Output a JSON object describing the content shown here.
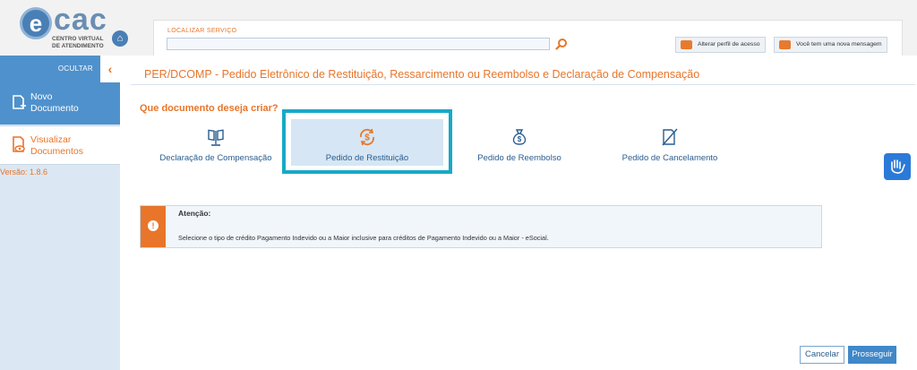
{
  "header": {
    "logo_text": "ecac",
    "logo_subtitle_1": "CENTRO VIRTUAL",
    "logo_subtitle_2": "DE ATENDIMENTO",
    "search_label": "LOCALIZAR SERVIÇO",
    "search_value": "",
    "profile_button": "Alterar perfil de acesso",
    "message_button": "Você tem uma nova mensagem"
  },
  "sidebar": {
    "hide_label": "OCULTAR",
    "new_document_line1": "Novo",
    "new_document_line2": "Documento",
    "view_documents_line1": "Visualizar",
    "view_documents_line2": "Documentos",
    "version": "Versão: 1.8.6"
  },
  "main": {
    "page_title": "PER/DCOMP - Pedido Eletrônico de Restituição, Ressarcimento ou Reembolso e Declaração de Compensação",
    "question": "Que documento deseja criar?",
    "options": [
      {
        "label": "Declaração de Compensação",
        "icon": "scale-icon",
        "selected": false
      },
      {
        "label": "Pedido de Restituição",
        "icon": "refund-cycle-icon",
        "selected": true
      },
      {
        "label": "Pedido de Reembolso",
        "icon": "money-bag-icon",
        "selected": false
      },
      {
        "label": "Pedido de Cancelamento",
        "icon": "cancel-document-icon",
        "selected": false
      }
    ]
  },
  "alert": {
    "title": "Atenção:",
    "text": "Selecione o tipo de crédito Pagamento Indevido ou a Maior inclusive para créditos de Pagamento Indevido ou a Maior - eSocial."
  },
  "actions": {
    "cancel_label": "Cancelar",
    "next_label": "Prosseguir"
  },
  "colors": {
    "accent": "#e8752a",
    "primary_blue": "#4f91cc",
    "selection_border": "#17a9c6",
    "link_blue": "#2a5d8f"
  }
}
